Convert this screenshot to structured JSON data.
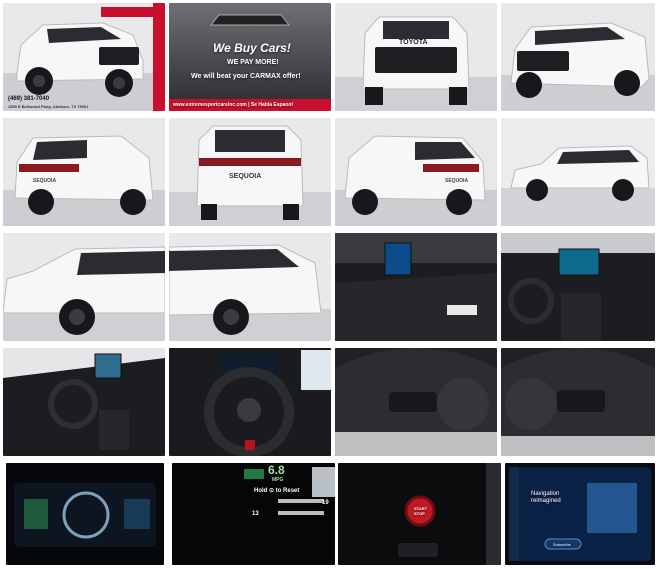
{
  "dealer": {
    "phone": "(469) 381-7040",
    "address": "1550 E Beltwood Pkwy, Addison, TX 75001",
    "ad_headline": "We Buy Cars!",
    "ad_line2": "WE PAY MORE!",
    "ad_line3": "We will beat your CARMAX offer!",
    "ad_footer": "www.extremesportcarsinc.com | Se Habla Espanol"
  },
  "vehicle": {
    "grille_badge": "TOYOTA",
    "tailgate_badge": "SEQUOIA"
  },
  "dash": {
    "mpg_value": "6.8",
    "mpg_unit": "MPG",
    "reset_hint": "Hold ⊙ to Reset",
    "odo_a": "19",
    "odo_b": "13",
    "start_button": "START\nSTOP"
  },
  "screen": {
    "title": "Navigation\nreimagined",
    "button": "Subscribe"
  },
  "colors": {
    "studio_bg": "#e9e9eb",
    "floor": "#cfd0d3",
    "vehicle_white": "#f7f7f7",
    "interior_dark": "#1c1d20",
    "ad_red": "#c8102e"
  }
}
